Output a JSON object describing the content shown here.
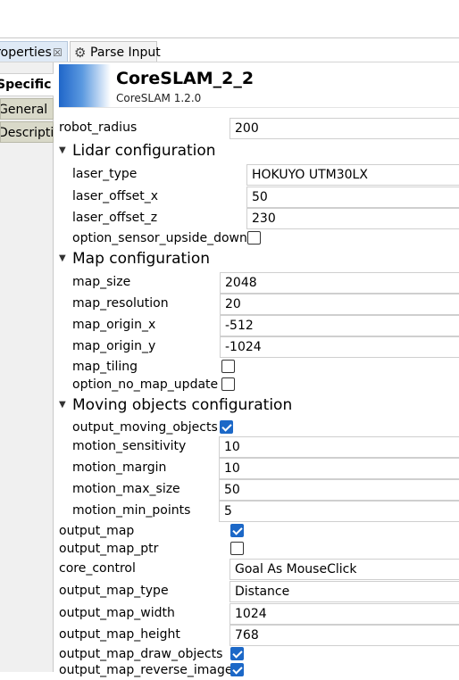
{
  "tabs": {
    "properties": "Properties",
    "parse_input": "Parse Input"
  },
  "sidebar": {
    "specific": "Specific",
    "general": "General",
    "description": "Description"
  },
  "header": {
    "title": "CoreSLAM_2_2",
    "subtitle": "CoreSLAM 1.2.0"
  },
  "props": {
    "robot_radius": {
      "label": "robot_radius",
      "value": "200"
    },
    "lidar": {
      "title": "Lidar configuration",
      "laser_type": {
        "label": "laser_type",
        "value": "HOKUYO UTM30LX"
      },
      "laser_offset_x": {
        "label": "laser_offset_x",
        "value": "50"
      },
      "laser_offset_z": {
        "label": "laser_offset_z",
        "value": "230"
      },
      "option_sensor_upside_down": {
        "label": "option_sensor_upside_down",
        "checked": false
      }
    },
    "map": {
      "title": "Map configuration",
      "map_size": {
        "label": "map_size",
        "value": "2048"
      },
      "map_resolution": {
        "label": "map_resolution",
        "value": "20"
      },
      "map_origin_x": {
        "label": "map_origin_x",
        "value": "-512"
      },
      "map_origin_y": {
        "label": "map_origin_y",
        "value": "-1024"
      },
      "map_tiling": {
        "label": "map_tiling",
        "checked": false
      },
      "option_no_map_update": {
        "label": "option_no_map_update",
        "checked": false
      }
    },
    "moving": {
      "title": "Moving objects configuration",
      "output_moving_objects": {
        "label": "output_moving_objects",
        "checked": true
      },
      "motion_sensitivity": {
        "label": "motion_sensitivity",
        "value": "10"
      },
      "motion_margin": {
        "label": "motion_margin",
        "value": "10"
      },
      "motion_max_size": {
        "label": "motion_max_size",
        "value": "50"
      },
      "motion_min_points": {
        "label": "motion_min_points",
        "value": "5"
      }
    },
    "output_map": {
      "label": "output_map",
      "checked": true
    },
    "output_map_ptr": {
      "label": "output_map_ptr",
      "checked": false
    },
    "core_control": {
      "label": "core_control",
      "value": "Goal As MouseClick"
    },
    "output_map_type": {
      "label": "output_map_type",
      "value": "Distance"
    },
    "output_map_width": {
      "label": "output_map_width",
      "value": "1024"
    },
    "output_map_height": {
      "label": "output_map_height",
      "value": "768"
    },
    "output_map_draw_objects": {
      "label": "output_map_draw_objects",
      "checked": true
    },
    "output_map_reverse_image": {
      "label": "output_map_reverse_image",
      "checked": true
    }
  },
  "colors": {
    "accent": "#1c68c7",
    "sidebar_tab": "#d9d9c9"
  }
}
